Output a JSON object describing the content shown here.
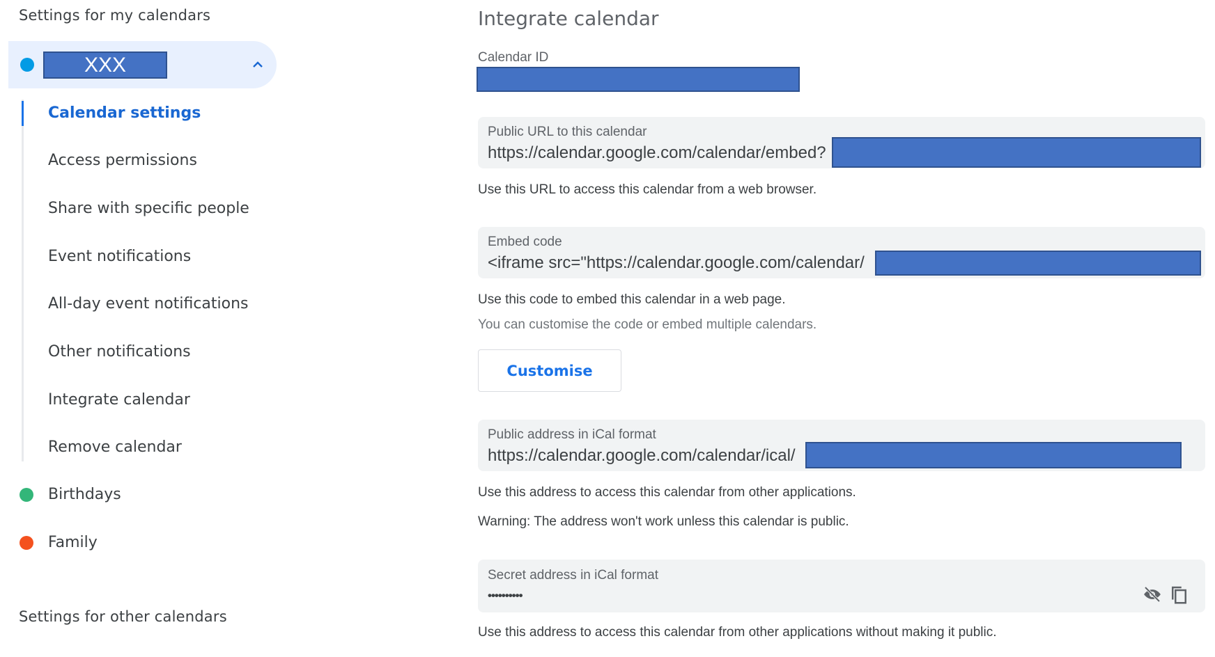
{
  "sidebar": {
    "heading_my": "Settings for my calendars",
    "heading_other": "Settings for other calendars",
    "selected_calendar": {
      "name": "XXX",
      "color": "#039be5",
      "expanded": true
    },
    "subnav": [
      {
        "label": "Calendar settings",
        "active": true
      },
      {
        "label": "Access permissions",
        "active": false
      },
      {
        "label": "Share with specific people",
        "active": false
      },
      {
        "label": "Event notifications",
        "active": false
      },
      {
        "label": "All-day event notifications",
        "active": false
      },
      {
        "label": "Other notifications",
        "active": false
      },
      {
        "label": "Integrate calendar",
        "active": false
      },
      {
        "label": "Remove calendar",
        "active": false
      }
    ],
    "other_my_calendars": [
      {
        "label": "Birthdays",
        "color": "#33b679"
      },
      {
        "label": "Family",
        "color": "#f4511e"
      }
    ]
  },
  "main": {
    "title": "Integrate calendar",
    "calendar_id": {
      "label": "Calendar ID",
      "value_redacted": true
    },
    "public_url": {
      "label": "Public URL to this calendar",
      "value": "https://calendar.google.com/calendar/embed?",
      "help": "Use this URL to access this calendar from a web browser."
    },
    "embed_code": {
      "label": "Embed code",
      "value": "<iframe src=\"https://calendar.google.com/calendar/",
      "help": "Use this code to embed this calendar in a web page.",
      "help_secondary": "You can customise the code or embed multiple calendars.",
      "customise_button": "Customise"
    },
    "public_ical": {
      "label": "Public address in iCal format",
      "value": "https://calendar.google.com/calendar/ical/",
      "help": "Use this address to access this calendar from other applications.",
      "warning": "Warning: The address won't work unless this calendar is public."
    },
    "secret_ical": {
      "label": "Secret address in iCal format",
      "value": "••••••••••",
      "help": "Use this address to access this calendar from other applications without making it public.",
      "icons": [
        "visibility-off-icon",
        "copy-icon"
      ]
    }
  },
  "colors": {
    "accent": "#1a73e8",
    "selected_bg": "#e8f0fe",
    "field_bg": "#f1f3f4",
    "redaction": "#4472c4"
  }
}
